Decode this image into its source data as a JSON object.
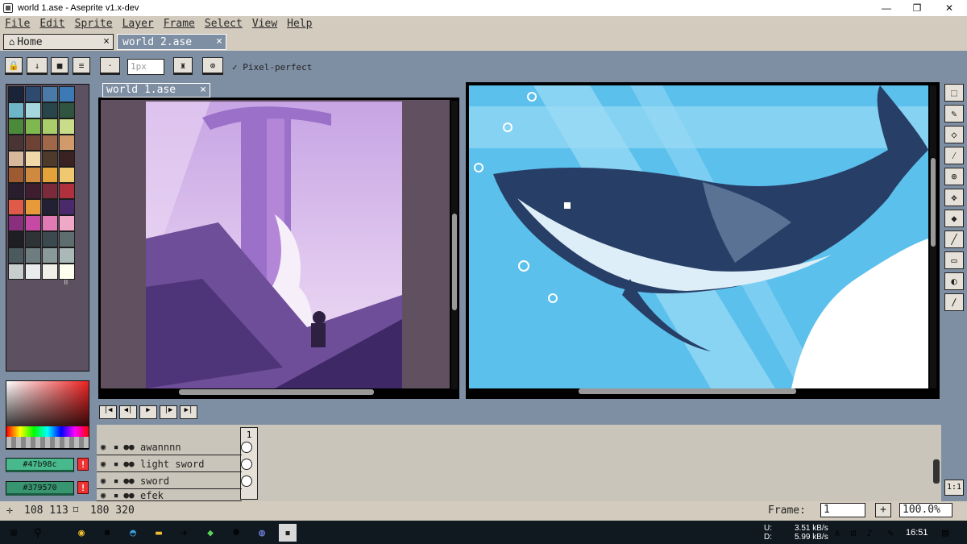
{
  "window": {
    "title": "world 1.ase - Aseprite v1.x-dev",
    "minimize": "—",
    "restore": "❐",
    "close": "✕"
  },
  "menu": [
    "File",
    "Edit",
    "Sprite",
    "Layer",
    "Frame",
    "Select",
    "View",
    "Help"
  ],
  "tabs": [
    {
      "label": "Home",
      "icon": "home-icon",
      "close": "×"
    },
    {
      "label": "world 2.ase",
      "close": "×"
    }
  ],
  "toolbar": {
    "brush_size": "1px",
    "pixel_perfect": "Pixel-perfect",
    "check": "✓"
  },
  "editor": {
    "tab_label": "world 1.ase",
    "tab_close": "×"
  },
  "palette": {
    "colors": [
      "#1a2438",
      "#2e4a6e",
      "#4a7aa8",
      "#3c7ab6",
      "#6fb5c8",
      "#a5d8de",
      "#27454a",
      "#2f5440",
      "#4a8a3a",
      "#7eb84e",
      "#aace6a",
      "#c9dc8a",
      "#4a3434",
      "#6e4234",
      "#a0674a",
      "#d09a6a",
      "#d8b89a",
      "#f0d8a8",
      "#4e3a2a",
      "#3a2222",
      "#9e5a30",
      "#d08a40",
      "#e4a23a",
      "#f0c870",
      "#2a1e2e",
      "#3e1e2e",
      "#7a2a3a",
      "#b0303e",
      "#e05a4a",
      "#e89a3a",
      "#222034",
      "#4a2a6a",
      "#8a2e7e",
      "#c64aa4",
      "#e07ab4",
      "#f0a8c8",
      "#1e1e24",
      "#2e3436",
      "#3a4a4e",
      "#5e6e70",
      "#4a5a5e",
      "#6e7e80",
      "#8a9a9a",
      "#aab8b8",
      "#c8cece",
      "#e8ecec",
      "#f0f0e8",
      "#fffff0"
    ]
  },
  "colors": {
    "foreground": "#47b98c",
    "background": "#379570",
    "warn": "!"
  },
  "timeline": {
    "layers": [
      "awannnn",
      "light sword",
      "sword",
      "efek"
    ],
    "frame_number": "1"
  },
  "status": {
    "cursor": "108 113",
    "size": "180 320",
    "frame_label": "Frame:",
    "frame_value": "1",
    "zoom": "100.0%",
    "plus": "+",
    "one_to_one": "1:1"
  },
  "taskbar": {
    "net_up": "3.51 kB/s",
    "net_down": "5.99 kB/s",
    "up_label": "U:",
    "down_label": "D:",
    "time": "16:51"
  }
}
